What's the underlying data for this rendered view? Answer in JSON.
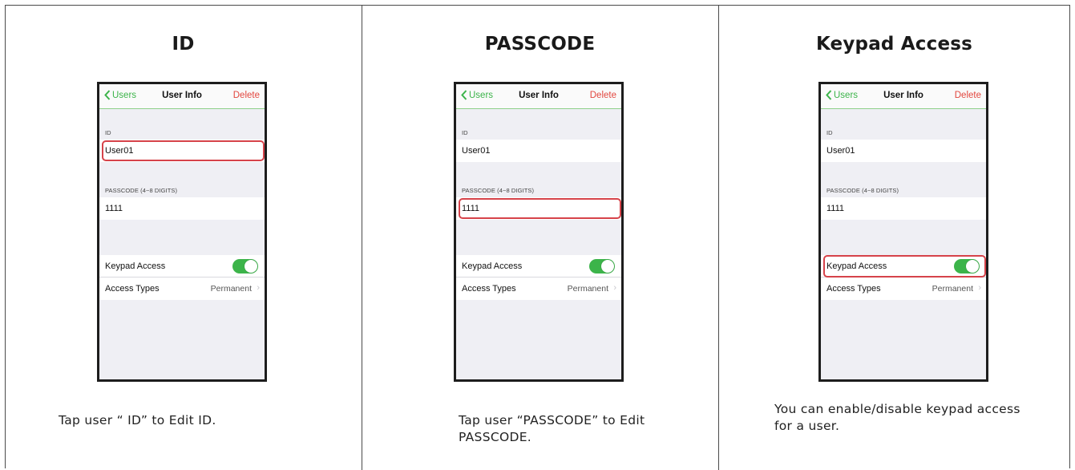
{
  "panels": [
    {
      "title": "ID",
      "caption": "Tap user “ ID” to Edit ID.",
      "highlight": "id"
    },
    {
      "title": "PASSCODE",
      "caption": "Tap user “PASSCODE” to Edit PASSCODE.",
      "highlight": "passcode"
    },
    {
      "title": "Keypad Access",
      "caption": "You can enable/disable keypad access for a user.",
      "highlight": "keypad"
    }
  ],
  "phone": {
    "back_label": "Users",
    "nav_title": "User Info",
    "delete_label": "Delete",
    "id_label": "ID",
    "id_value": "User01",
    "passcode_label": "PASSCODE (4~8 DIGITS)",
    "passcode_value": "1111",
    "keypad_label": "Keypad Access",
    "keypad_enabled": true,
    "access_types_label": "Access Types",
    "access_types_value": "Permanent",
    "chevron": "›"
  },
  "colors": {
    "accent_green": "#3cb44a",
    "delete_red": "#e2473f",
    "highlight_red": "#d6434a"
  },
  "icons": {
    "back": "chevron-left-icon",
    "disclosure": "chevron-right-icon"
  }
}
